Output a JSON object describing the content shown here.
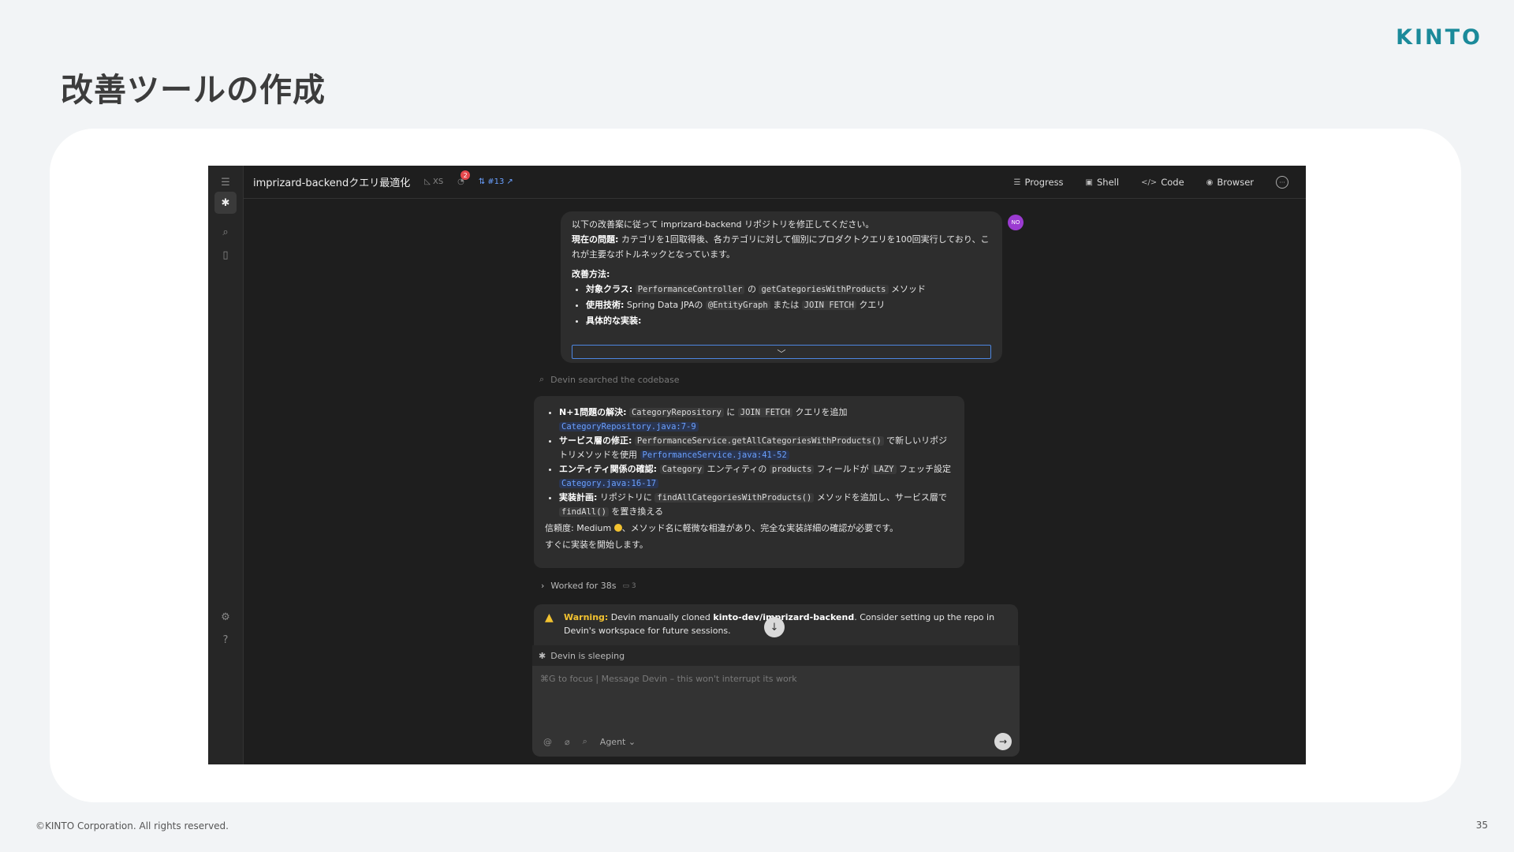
{
  "slide": {
    "title": "改善ツールの作成",
    "logo": "KINTO",
    "copyright": "©KINTO Corporation. All rights reserved.",
    "page_number": "35"
  },
  "app": {
    "session_title": "imprizard-backendクエリ最適化",
    "size_tag": "XS",
    "notification_count": "2",
    "pr_label": "#13",
    "top_buttons": {
      "progress": "Progress",
      "shell": "Shell",
      "code": "Code",
      "browser": "Browser"
    },
    "user_avatar": "NO",
    "user_message": {
      "line1": "以下の改善案に従って imprizard-backend リポジトリを修正してください。",
      "problem_label": "現在の問題:",
      "problem_text": " カテゴリを1回取得後、各カテゴリに対して個別にプロダクトクエリを100回実行しており、これが主要なボトルネックとなっています。",
      "method_label": "改善方法:",
      "items": [
        {
          "label": "対象クラス:",
          "code1": "PerformanceController",
          "mid": " の ",
          "code2": "getCategoriesWithProducts",
          "tail": " メソッド"
        },
        {
          "label": "使用技術:",
          "pre": " Spring Data JPAの ",
          "code1": "@EntityGraph",
          "mid": " または ",
          "code2": "JOIN FETCH",
          "tail": " クエリ"
        },
        {
          "label": "具体的な実装:"
        }
      ]
    },
    "search_note": "Devin searched the codebase",
    "devin_message": {
      "items": [
        {
          "label": "N+1問題の解決:",
          "code1": "CategoryRepository",
          "mid": " に ",
          "code2": "JOIN FETCH",
          "tail": " クエリを追加",
          "link": "CategoryRepository.java:7-9"
        },
        {
          "label": "サービス層の修正:",
          "code1": "PerformanceService.getAllCategoriesWithProducts()",
          "tail": " で新しいリポジトリメソッドを使用",
          "link": "PerformanceService.java:41-52"
        },
        {
          "label": "エンティティ関係の確認:",
          "code1": "Category",
          "mid": " エンティティの ",
          "code2": "products",
          "mid2": " フィールドが ",
          "code3": "LAZY",
          "tail": " フェッチ設定",
          "link": "Category.java:16-17"
        },
        {
          "label": "実装計画:",
          "pre": " リポジトリに ",
          "code1": "findAllCategoriesWithProducts()",
          "mid": " メソッドを追加し、サービス層で ",
          "code2": "findAll()",
          "tail": " を置き換える"
        }
      ],
      "confidence_prefix": "信頼度: Medium",
      "confidence_suffix": "、メソッド名に軽微な相違があり、完全な実装詳細の確認が必要です。",
      "closing": "すぐに実装を開始します。"
    },
    "worked": {
      "label": "Worked for 38s",
      "count": "3"
    },
    "warning": {
      "label": "Warning:",
      "text1": " Devin manually cloned ",
      "repo": "kinto-dev/imprizard-backend",
      "text2": ". Consider setting up the repo in Devin's workspace for future sessions."
    },
    "sleep_status": "Devin is sleeping",
    "composer": {
      "placeholder": "⌘G to focus | Message Devin – this won't interrupt its work",
      "agent_label": "Agent"
    }
  }
}
